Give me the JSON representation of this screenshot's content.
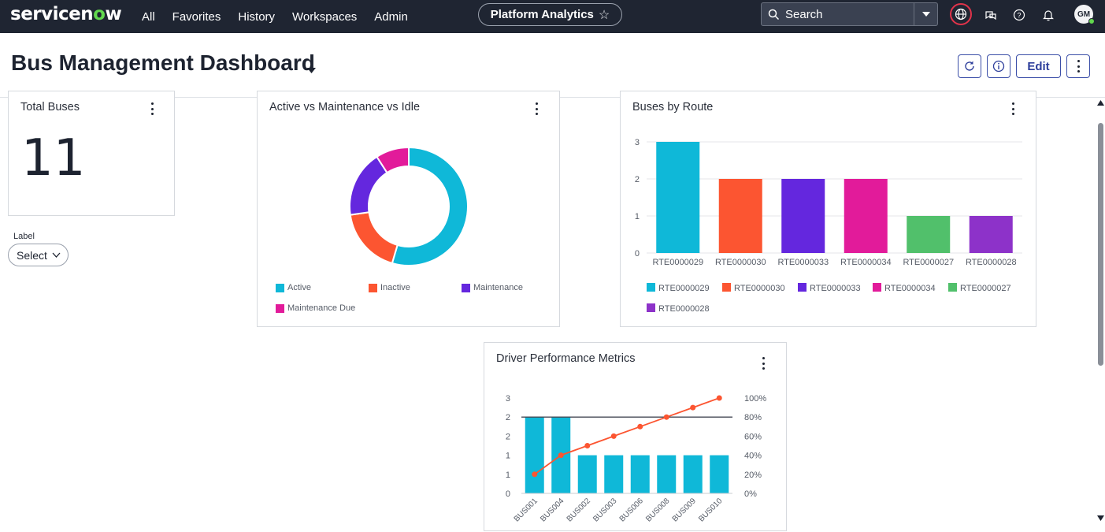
{
  "nav": {
    "logo_pre": "servicen",
    "logo_o": "o",
    "logo_post": "w",
    "items": [
      "All",
      "Favorites",
      "History",
      "Workspaces",
      "Admin"
    ],
    "context_pill": "Platform Analytics",
    "search_placeholder": "Search",
    "avatar_initials": "GM",
    "icons": [
      "globe-icon",
      "chat-icon",
      "help-icon",
      "bell-icon"
    ]
  },
  "header": {
    "title": "Bus Management Dashboard",
    "edit_label": "Edit"
  },
  "widgets": {
    "total_buses": {
      "title": "Total Buses",
      "value": "11"
    },
    "filter": {
      "label": "Label",
      "value": "Select"
    },
    "donut": {
      "title": "Active vs Maintenance vs Idle",
      "legend": [
        "Active",
        "Inactive",
        "Maintenance",
        "Maintenance Due"
      ]
    },
    "route": {
      "title": "Buses by Route"
    },
    "driver": {
      "title": "Driver Performance Metrics"
    }
  },
  "colors": {
    "nav_bg": "#1f2532",
    "accent": "#2d3e9b",
    "cyan": "#0fb8d8",
    "orange": "#fc5531",
    "purple": "#6427de",
    "magenta": "#e21b9a",
    "green": "#51c06b",
    "violet": "#8d32c9"
  },
  "chart_data": [
    {
      "type": "pie",
      "categories": [
        "Active",
        "Inactive",
        "Maintenance",
        "Maintenance Due"
      ],
      "values": [
        6,
        2,
        2,
        1
      ],
      "colors": [
        "#0fb8d8",
        "#fc5531",
        "#6427de",
        "#e21b9a"
      ]
    },
    {
      "type": "bar",
      "categories": [
        "RTE0000029",
        "RTE0000030",
        "RTE0000033",
        "RTE0000034",
        "RTE0000027",
        "RTE0000028"
      ],
      "values": [
        3,
        2,
        2,
        2,
        1,
        1
      ],
      "colors": [
        "#0fb8d8",
        "#fc5531",
        "#6427de",
        "#e21b9a",
        "#51c06b",
        "#8d32c9"
      ],
      "ylim": [
        0,
        3
      ],
      "yticks": [
        "0",
        "1",
        "2",
        "3"
      ],
      "legend": "bottom"
    },
    {
      "type": "bar",
      "categories": [
        "BUS001",
        "BUS004",
        "BUS002",
        "BUS003",
        "BUS006",
        "BUS008",
        "BUS009",
        "BUS010"
      ],
      "values": [
        2,
        2,
        1,
        1,
        1,
        1,
        1,
        1
      ],
      "ylim": [
        0,
        2.5
      ],
      "yticks": [
        "0",
        "1",
        "1",
        "2",
        "2",
        "3"
      ],
      "y2ticks": [
        "0%",
        "20%",
        "40%",
        "60%",
        "80%",
        "100%"
      ],
      "series": [
        {
          "values": [
            2,
            2,
            1,
            1,
            1,
            1,
            1,
            1
          ]
        },
        {
          "values": [
            20,
            40,
            50,
            60,
            70,
            80,
            90,
            100
          ]
        }
      ],
      "reference_line": 2
    }
  ]
}
